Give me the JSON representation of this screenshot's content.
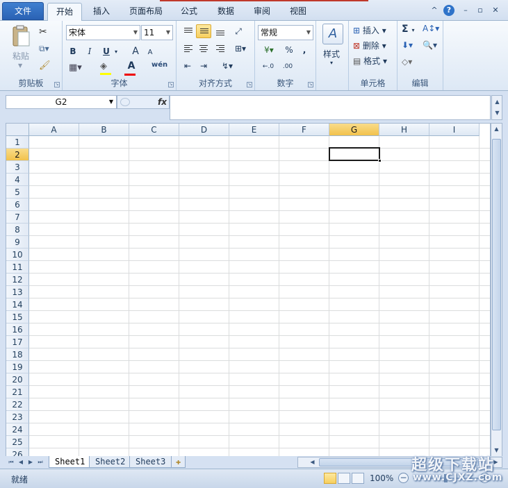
{
  "tabs": {
    "file": "文件",
    "items": [
      "开始",
      "插入",
      "页面布局",
      "公式",
      "数据",
      "审阅",
      "视图"
    ]
  },
  "window_controls": {
    "collapse": "^",
    "help": "?",
    "minimize": "–",
    "restore": "▫",
    "close": "✕"
  },
  "ribbon": {
    "clipboard": {
      "label": "剪贴板",
      "paste": "粘贴"
    },
    "font": {
      "label": "字体",
      "name": "宋体",
      "size": "11",
      "bold": "B",
      "italic": "I",
      "underline": "U",
      "grow": "A",
      "shrink": "A",
      "font_color": "A",
      "phonetic": "wén"
    },
    "alignment": {
      "label": "对齐方式"
    },
    "number": {
      "label": "数字",
      "format": "常规",
      "percent": "%",
      "comma": ",",
      "increase_decimal": "←.0",
      "decrease_decimal": ".00"
    },
    "styles": {
      "label": "样式"
    },
    "cells": {
      "label": "单元格",
      "insert": "插入",
      "delete": "删除",
      "format": "格式"
    },
    "editing": {
      "label": "编辑",
      "sum": "Σ"
    }
  },
  "formula_bar": {
    "name_box": "G2",
    "fx": "fx",
    "value": ""
  },
  "columns": [
    "A",
    "B",
    "C",
    "D",
    "E",
    "F",
    "G",
    "H",
    "I"
  ],
  "selected_column": "G",
  "rows": [
    "1",
    "2",
    "3",
    "4",
    "5",
    "6",
    "7",
    "8",
    "9",
    "10",
    "11",
    "12",
    "13",
    "14",
    "15",
    "16",
    "17",
    "18",
    "19",
    "20",
    "21",
    "22",
    "23",
    "24",
    "25",
    "26"
  ],
  "selected_row": "2",
  "sheets": [
    "Sheet1",
    "Sheet2",
    "Sheet3"
  ],
  "active_sheet": "Sheet1",
  "status": {
    "ready": "就绪",
    "zoom": "100%",
    "zoom_minus": "−",
    "zoom_plus": "+"
  },
  "watermark": {
    "cn": "超级下载站",
    "en": "www.CJXZ.com"
  },
  "colors": {
    "accent": "#2a62b4",
    "selection": "#f2c24c",
    "ribbon_bg": "#dde8f5"
  }
}
